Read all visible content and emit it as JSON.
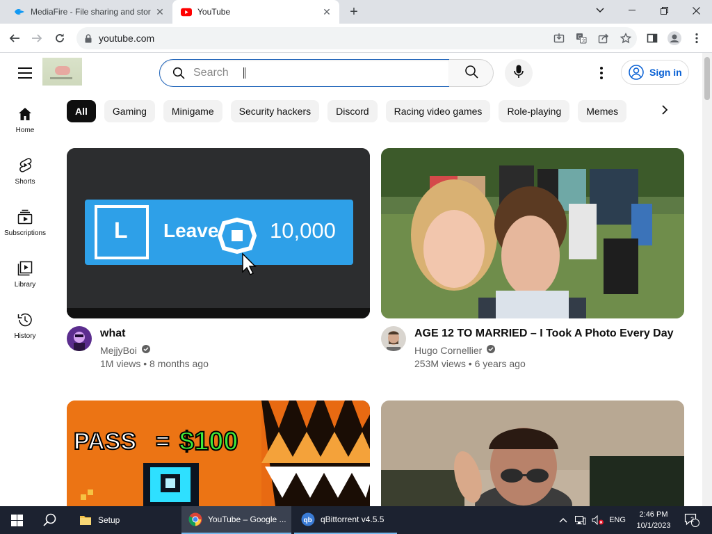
{
  "browser": {
    "tabs": [
      {
        "title": "MediaFire - File sharing and stor",
        "active": false
      },
      {
        "title": "YouTube",
        "active": true
      }
    ],
    "url": "youtube.com"
  },
  "youtube": {
    "search_placeholder": "Search",
    "signin_label": "Sign in",
    "guide": [
      {
        "label": "Home",
        "icon": "home-icon"
      },
      {
        "label": "Shorts",
        "icon": "shorts-icon"
      },
      {
        "label": "Subscriptions",
        "icon": "subscriptions-icon"
      },
      {
        "label": "Library",
        "icon": "library-icon"
      },
      {
        "label": "History",
        "icon": "history-icon"
      }
    ],
    "chips": [
      "All",
      "Gaming",
      "Minigame",
      "Security hackers",
      "Discord",
      "Racing video games",
      "Role-playing",
      "Memes"
    ],
    "videos": [
      {
        "title": "what",
        "channel": "MejjyBoi",
        "stats": "1M views • 8 months ago",
        "thumb_text": {
          "key": "L",
          "action": "Leave",
          "amount": "10,000"
        }
      },
      {
        "title": "AGE 12 TO MARRIED – I Took A Photo Every Day",
        "channel": "Hugo Cornellier",
        "stats": "253M views • 6 years ago"
      },
      {
        "thumb_text": {
          "pass": "PASS",
          "equals": "=",
          "price": "$100"
        }
      },
      {}
    ]
  },
  "taskbar": {
    "apps": [
      {
        "label": "Setup"
      },
      {
        "label": "YouTube – Google ..."
      },
      {
        "label": "qBittorrent v4.5.5"
      }
    ],
    "language": "ENG",
    "time": "2:46 PM",
    "date": "10/1/2023",
    "notification_count": "2"
  },
  "colors": {
    "accent_blue": "#065fd4",
    "youtube_red": "#ff0000",
    "roblox_blue": "#2ea0e8",
    "taskbar_bg": "#1c2230"
  }
}
